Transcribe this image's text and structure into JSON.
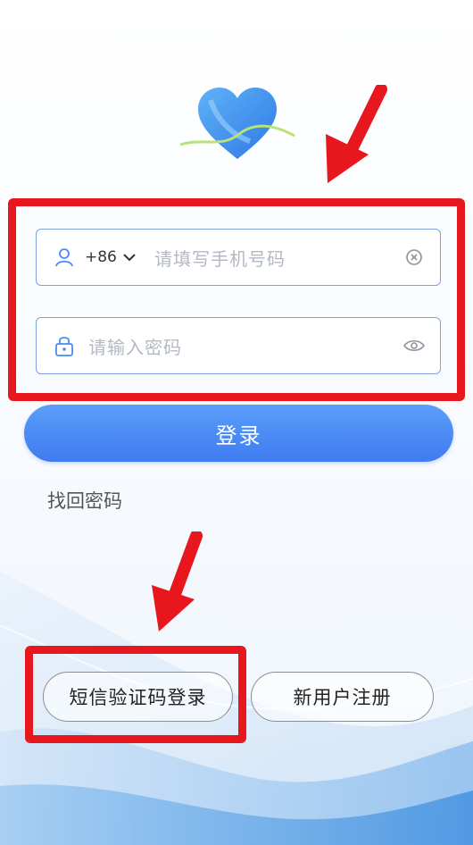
{
  "login_form": {
    "country_code": "+86",
    "phone_placeholder": "请填写手机号码",
    "password_placeholder": "请输入密码"
  },
  "actions": {
    "login_label": "登录",
    "forgot_password_label": "找回密码",
    "sms_login_label": "短信验证码登录",
    "register_label": "新用户注册"
  },
  "colors": {
    "accent": "#4a8af6",
    "highlight_red": "#e8161d",
    "field_border": "#7aa3de"
  },
  "icons": {
    "phone_field": [
      "user-icon",
      "chevron-down-icon",
      "clear-icon"
    ],
    "password_field": [
      "lock-icon",
      "eye-icon"
    ]
  }
}
